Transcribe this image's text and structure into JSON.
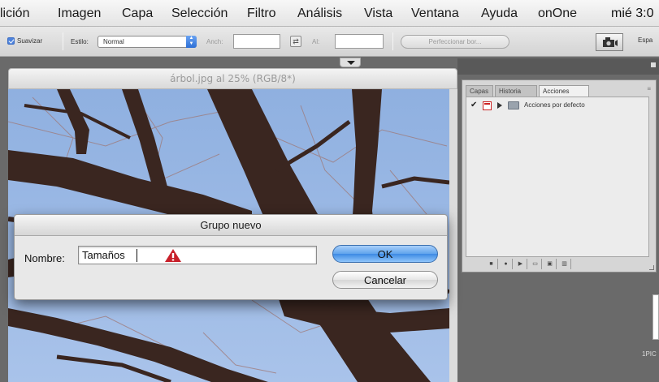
{
  "menubar": {
    "items": [
      "lición",
      "Imagen",
      "Capa",
      "Selección",
      "Filtro",
      "Análisis",
      "Vista",
      "Ventana",
      "Ayuda",
      "onOne"
    ],
    "clock": "mié 3:0"
  },
  "options_bar": {
    "smooth_label": "Suavizar",
    "style_label": "Estilo:",
    "style_value": "Normal",
    "width_label": "Anch:",
    "height_label": "Al:",
    "refine_edge_label": "Perfeccionar bor...",
    "workspace_label": "Espa"
  },
  "document": {
    "title": "árbol.jpg al 25% (RGB/8*)"
  },
  "panel": {
    "tabs": [
      "Capas",
      "Historia",
      "Acciones"
    ],
    "active_tab": "Acciones",
    "action_set_label": "Acciones por defecto"
  },
  "dialog": {
    "title": "Grupo nuevo",
    "name_label": "Nombre:",
    "name_value": "Tamaños",
    "ok_label": "OK",
    "cancel_label": "Cancelar"
  },
  "right_pane": {
    "label": "1PIC"
  },
  "colors": {
    "ok_button": "#5fa3ec",
    "sky": "#9cb8e4",
    "bark": "#3a2620",
    "panel_bg": "#d6d6d6",
    "workspace_bg": "#6a6a6a"
  }
}
